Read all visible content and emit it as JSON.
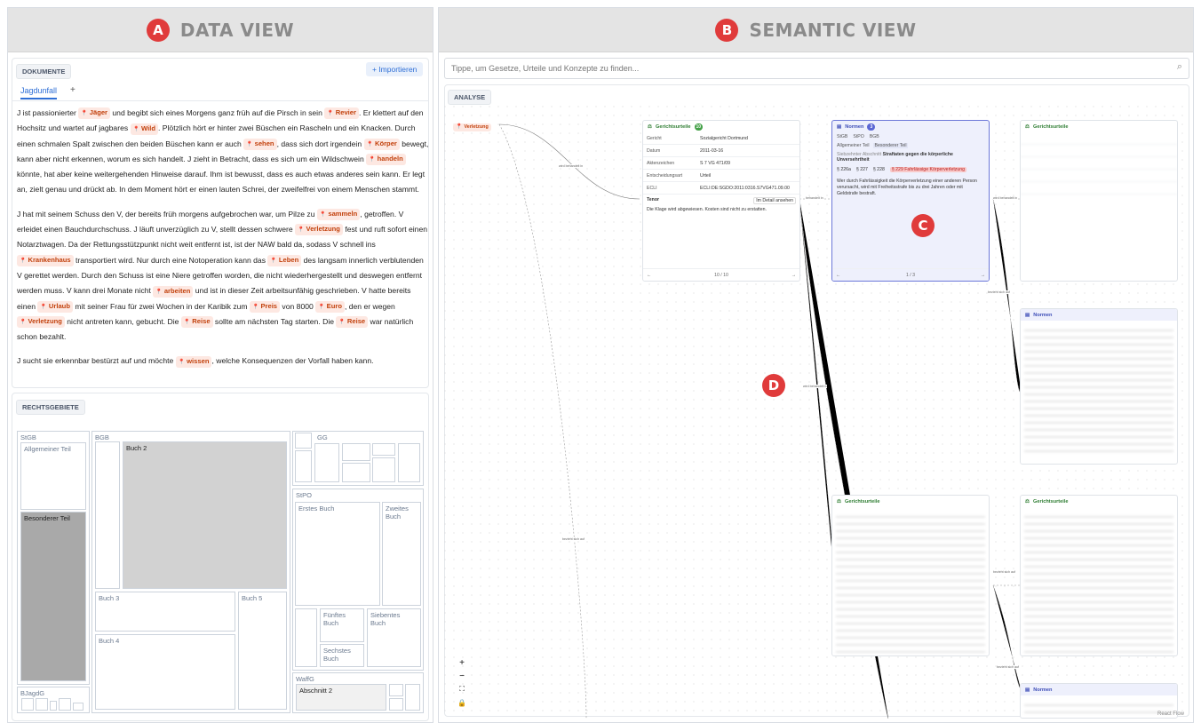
{
  "panes": {
    "a": {
      "badge": "A",
      "title": "DATA VIEW"
    },
    "b": {
      "badge": "B",
      "title": "SEMANTIC VIEW"
    }
  },
  "documents": {
    "section": "DOKUMENTE",
    "import_label": "+ Importieren",
    "tab": "Jagdunfall",
    "add_tab": "+",
    "paragraphs": [
      [
        {
          "t": "J ist passionierter "
        },
        {
          "e": "Jäger"
        },
        {
          "t": " und begibt sich eines Morgens ganz früh auf die Pirsch in sein "
        },
        {
          "e": "Revier"
        },
        {
          "t": ". Er klettert auf den Hochsitz und wartet auf jagbares "
        },
        {
          "e": "Wild"
        },
        {
          "t": ". Plötzlich hört er hinter zwei Büschen ein Rascheln und ein Knacken. Durch einen schmalen Spalt zwischen den beiden Büschen kann er auch "
        },
        {
          "e": "sehen"
        },
        {
          "t": ", dass sich dort irgendein "
        },
        {
          "e": "Körper"
        },
        {
          "t": " bewegt, kann aber nicht erkennen, worum es sich handelt. J zieht in Betracht, dass es sich um ein Wildschwein "
        },
        {
          "e": "handeln"
        },
        {
          "t": " könnte, hat aber keine weitergehenden Hinweise darauf. Ihm ist bewusst, dass es auch etwas anderes sein kann. Er legt an, zielt genau und drückt ab. In dem Moment hört er einen lauten Schrei, der zweifelfrei von einem Menschen stammt."
        }
      ],
      [
        {
          "t": "J hat mit seinem Schuss den V, der bereits früh morgens aufgebrochen war, um Pilze zu "
        },
        {
          "e": "sammeln"
        },
        {
          "t": ", getroffen. V erleidet einen Bauchdurchschuss. J läuft unverzüglich zu V, stellt dessen schwere "
        },
        {
          "e": "Verletzung"
        },
        {
          "t": " fest und ruft sofort einen Notarztwagen. Da der Rettungsstützpunkt nicht weit entfernt ist, ist der NAW bald da, sodass V schnell ins "
        },
        {
          "e": "Krankenhaus"
        },
        {
          "t": " transportiert wird. Nur durch eine Notoperation kann das "
        },
        {
          "e": "Leben"
        },
        {
          "t": " des langsam innerlich verblutenden V gerettet werden. Durch den Schuss ist eine Niere getroffen worden, die nicht wiederhergestellt und deswegen entfernt werden muss. V kann drei Monate nicht "
        },
        {
          "e": "arbeiten"
        },
        {
          "t": " und ist in dieser Zeit arbeitsunfähig geschrieben. V hatte bereits einen "
        },
        {
          "e": "Urlaub"
        },
        {
          "t": " mit seiner Frau für zwei Wochen in der Karibik zum "
        },
        {
          "e": "Preis"
        },
        {
          "t": " von 8000 "
        },
        {
          "e": "Euro"
        },
        {
          "t": ", den er wegen "
        },
        {
          "e": "Verletzung"
        },
        {
          "t": " nicht antreten kann, gebucht. Die "
        },
        {
          "e": "Reise"
        },
        {
          "t": " sollte am nächsten Tag starten. Die "
        },
        {
          "e": "Reise"
        },
        {
          "t": " war natürlich schon bezahlt."
        }
      ],
      [
        {
          "t": "J sucht sie erkennbar bestürzt auf und möchte "
        },
        {
          "e": "wissen"
        },
        {
          "t": ", welche Konsequenzen der Vorfall haben kann."
        }
      ]
    ]
  },
  "legal_areas": {
    "section": "RECHTSGEBIETE",
    "labels": {
      "stgb": "StGB",
      "allgemeiner": "Allgemeiner Teil",
      "besonderer": "Besonderer Teil",
      "bgb": "BGB",
      "buch2": "Buch 2",
      "buch3": "Buch 3",
      "buch4": "Buch 4",
      "buch5": "Buch 5",
      "gg": "GG",
      "stpo": "StPO",
      "erstes": "Erstes Buch",
      "zweites": "Zweites Buch",
      "fuenftes": "Fünftes Buch",
      "siebentes": "Siebentes Buch",
      "sechstes": "Sechstes Buch",
      "bjagdg": "BJagdG",
      "waffg": "WaffG",
      "abschnitt2": "Abschnitt 2"
    }
  },
  "semantic": {
    "search_placeholder": "Tippe, um Gesetze, Urteile und Konzepte zu finden...",
    "analysis": "ANALYSE",
    "source_node": "Verletzung",
    "edge_labels": [
      "wird behandelt in",
      "behandelt in",
      "bezieht sich auf",
      "wird behandelt in",
      "bezieht sich auf",
      "bezieht sich auf",
      "wird behandelt in",
      "bezieht sich auf"
    ],
    "judgment": {
      "title": "Gerichtsurteile",
      "count": "10",
      "rows": [
        {
          "k": "Gericht",
          "v": "Sozialgericht Dortmund"
        },
        {
          "k": "Datum",
          "v": "2011-03-16"
        },
        {
          "k": "Aktenzeichen",
          "v": "S 7 VG 471/09"
        },
        {
          "k": "Entscheidungsart",
          "v": "Urteil"
        },
        {
          "k": "ECLI",
          "v": "ECLI:DE:SGDO:2011:0316.S7VG471.09.00"
        }
      ],
      "tenor": "Tenor",
      "detail": "Im Detail ansehen",
      "tenor_text": "Die Klage wird abgewiesen. Kosten sind nicht zu erstatten.",
      "pager": "10 / 10"
    },
    "norms": {
      "title": "Normen",
      "count": "3",
      "tabs": [
        "StGB",
        "StPO",
        "BGB"
      ],
      "subtabs": [
        "Allgemeiner Teil",
        "Besonderer Teil"
      ],
      "section_label": "Siebzehnter Abschnitt",
      "section_title": "Straftaten gegen die körperliche Unversehrtheit",
      "paras": [
        "§ 226a",
        "§ 227",
        "§ 228",
        "§ 229 Fahrlässige Körperverletzung"
      ],
      "text": "Wer durch Fahrlässigkeit die Körperverletzung einer anderen Person verursacht, wird mit Freiheitsstrafe bis zu drei Jahren oder mit Geldstrafe bestraft.",
      "pager": "1 / 3"
    },
    "markers": {
      "c": "C",
      "d": "D"
    },
    "blurred_titles": {
      "judgment": "Gerichtsurteile",
      "norms": "Normen"
    },
    "attribution": "React Flow",
    "controls": [
      "+",
      "−",
      "⛶",
      "🔒"
    ]
  }
}
